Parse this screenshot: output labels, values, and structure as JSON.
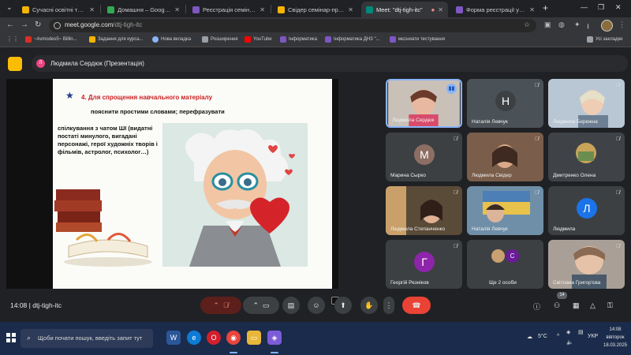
{
  "tabs": [
    {
      "title": "Сучасні освітні тренди сь",
      "color": "#f4b400",
      "active": false
    },
    {
      "title": "Домашня – Google Диск",
      "color": "#34a853",
      "active": false
    },
    {
      "title": "Реєстрація семінару маті",
      "color": "#7e57c2",
      "active": false
    },
    {
      "title": "Свідер семінар-презента",
      "color": "#f4b400",
      "active": false
    },
    {
      "title": "Meet: \"dtj-tigh-itc\"",
      "color": "#00897b",
      "active": true
    },
    {
      "title": "Форма реєстрації учасни",
      "color": "#7e57c2",
      "active": false
    }
  ],
  "address": {
    "host": "meet.google.com",
    "path": "/dtj-tigh-itc"
  },
  "bookmarks": [
    {
      "label": "~Avmodes5~ Billin...",
      "color": "#d93025"
    },
    {
      "label": "Задання для курса...",
      "color": "#f4b400"
    },
    {
      "label": "Нова вкладка",
      "color": "#8ab4f8"
    },
    {
      "label": "Розширення",
      "color": "#9aa0a6"
    },
    {
      "label": "YouTube",
      "color": "#ff0000"
    },
    {
      "label": "Інформатика",
      "color": "#7e57c2"
    },
    {
      "label": "Інформатика ДНЗ \"...",
      "color": "#7e57c2"
    },
    {
      "label": "мєсниати тестування",
      "color": "#7e57c2"
    }
  ],
  "all_bookmarks": "Усі закладки",
  "presenter": {
    "initial": "Л",
    "label": "Людмила Сердюк (Презентація)"
  },
  "slide": {
    "number": "4.",
    "title": "Для спрощення навчального матеріалу",
    "line2": "пояснити простими словами; перефразувати",
    "body": "спілкування з чатом ШІ (видатні постаті минулого, вигадані персонажі, герої художніх творів і фільмів, астролог, психолог…)"
  },
  "participants": [
    {
      "name": "Людмила Сердюк",
      "type": "photo",
      "speaking": true,
      "bg": "#c9c1b8"
    },
    {
      "name": "Наталія Левчук",
      "type": "initial",
      "initial": "Н",
      "bg": "#4a5257"
    },
    {
      "name": "Людмила Бережна",
      "type": "photo",
      "bg": "#b9c7d4"
    },
    {
      "name": "Марина Сырко",
      "type": "initial",
      "initial": "М",
      "bg": "#8d6e63"
    },
    {
      "name": "Людмила Свідер",
      "type": "photo",
      "bg": "#7a5d4a"
    },
    {
      "name": "Дмитренко Олена",
      "type": "photo",
      "bg": "#3f4347"
    },
    {
      "name": "Людмила Степанченко",
      "type": "photo",
      "bg": "#5a4a38"
    },
    {
      "name": "Наталія Левчук",
      "type": "photo",
      "bg": "#6f8fa8"
    },
    {
      "name": "Людмила",
      "type": "initial",
      "initial": "Л",
      "bg": "#1a73e8"
    },
    {
      "name": "Георгій Резніков",
      "type": "initial",
      "initial": "Г",
      "bg": "#8e24aa"
    },
    {
      "name": "Ще 2 особи",
      "type": "more",
      "initials": [
        "",
        "С"
      ],
      "bg": "#3c4043"
    },
    {
      "name": "Світлана Григор'єва",
      "type": "photo",
      "bg": "#a99f96"
    }
  ],
  "meeting": {
    "time": "14:08",
    "code": "dtj-tigh-itc",
    "people_count": "14"
  },
  "taskbar": {
    "search_placeholder": "Щоби почати пошук, введіть запит тут",
    "weather": "5°C",
    "lang": "УКР",
    "time": "14:08",
    "day": "вівторок",
    "date": "18.03.2025"
  }
}
